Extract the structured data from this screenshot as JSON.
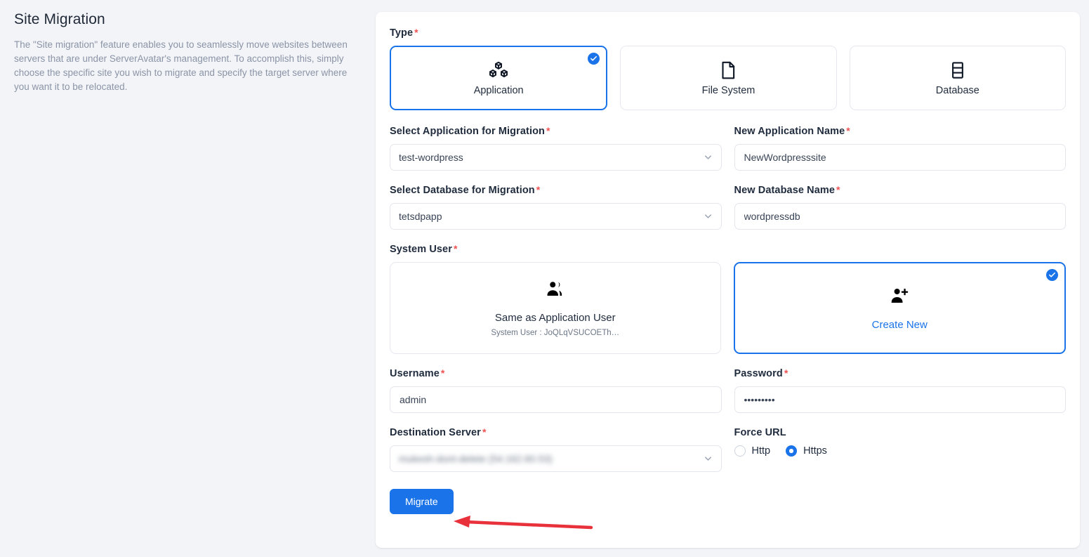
{
  "intro": {
    "title": "Site Migration",
    "description": "The \"Site migration\" feature enables you to seamlessly move websites between servers that are under ServerAvatar's management. To accomplish this, simply choose the specific site you wish to migrate and specify the target server where you want it to be relocated."
  },
  "colors": {
    "accent": "#1a73e8",
    "required": "#f05252",
    "page_bg": "#f3f4f8",
    "panel_bg": "#ffffff",
    "annotation_arrow": "#e8313a"
  },
  "form": {
    "type": {
      "label": "Type",
      "required": "*",
      "options": [
        {
          "label": "Application",
          "icon": "boxes-icon",
          "selected": true
        },
        {
          "label": "File System",
          "icon": "file-icon",
          "selected": false
        },
        {
          "label": "Database",
          "icon": "database-icon",
          "selected": false
        }
      ]
    },
    "select_application": {
      "label": "Select Application for Migration",
      "required": "*",
      "value": "test-wordpress"
    },
    "new_application_name": {
      "label": "New Application Name",
      "required": "*",
      "value": "NewWordpresssite"
    },
    "select_database": {
      "label": "Select Database for Migration",
      "required": "*",
      "value": "tetsdpapp"
    },
    "new_database_name": {
      "label": "New Database Name",
      "required": "*",
      "value": "wordpressdb"
    },
    "system_user": {
      "label": "System User",
      "required": "*",
      "options": [
        {
          "title": "Same as Application User",
          "subtitle": "System User :  JoQLqVSUCOETh…",
          "icon": "users-icon",
          "selected": false
        },
        {
          "title": "Create New",
          "subtitle": "",
          "icon": "user-plus-icon",
          "selected": true
        }
      ]
    },
    "username": {
      "label": "Username",
      "required": "*",
      "value": "admin"
    },
    "password": {
      "label": "Password",
      "required": "*",
      "value": "•••••••••"
    },
    "destination_server": {
      "label": "Destination Server",
      "required": "*",
      "value": "mukesh-dont-delete (54.162.60.53)",
      "redacted": true
    },
    "force_url": {
      "label": "Force URL",
      "options": [
        {
          "label": "Http",
          "selected": false
        },
        {
          "label": "Https",
          "selected": true
        }
      ]
    },
    "submit": {
      "label": "Migrate"
    }
  }
}
